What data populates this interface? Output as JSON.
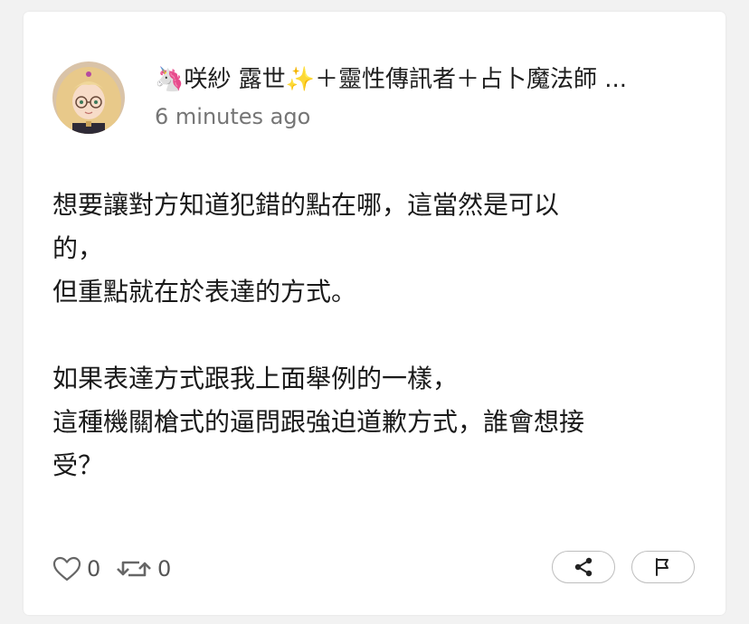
{
  "post": {
    "author": {
      "display_name": "🦄⁠咲紗 露世✨＋靈性傳訊者＋占卜魔法師 ...",
      "avatar": "avatar-girl-blonde-glasses"
    },
    "timestamp": "6 minutes ago",
    "body_lines": {
      "line1": "想要讓對方知道犯錯的點在哪，這當然是可以",
      "line2": "的，",
      "line3": "但重點就在於表達的方式。",
      "line4": "如果表達方式跟我上面舉例的一樣，",
      "line5": "這種機關槍式的逼問跟強迫道歉方式，誰會想接",
      "line6": "受？"
    },
    "stats": {
      "likes": "0",
      "reposts": "0"
    },
    "icons": {
      "like": "heart-icon",
      "repost": "repost-icon",
      "share": "share-icon",
      "report": "flag-icon"
    }
  },
  "colors": {
    "background": "#f2f2f2",
    "card": "#ffffff",
    "text_primary": "#1a1a1a",
    "text_secondary": "#757575"
  }
}
